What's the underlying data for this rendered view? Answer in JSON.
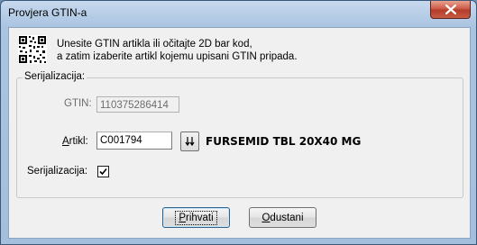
{
  "window": {
    "title": "Provjera GTIN-a",
    "close_label": "✕"
  },
  "instructions": {
    "line1": "Unesite GTIN artikla ili očitajte 2D bar kod,",
    "line2": "a zatim izaberite artikl kojemu upisani GTIN pripada."
  },
  "group": {
    "legend": "Serijalizacija:",
    "gtin_label": "GTIN:",
    "gtin_value": "110375286414",
    "artikl_label": "Artikl:",
    "artikl_value": "C001794",
    "lookup_glyph": "⇣",
    "artikl_name": "FURSEMID TBL 20X40 MG",
    "serial_label": "Serijalizacija:",
    "serial_checked": true
  },
  "buttons": {
    "ok_label": "Prihvati",
    "cancel_label": "Odustani"
  }
}
